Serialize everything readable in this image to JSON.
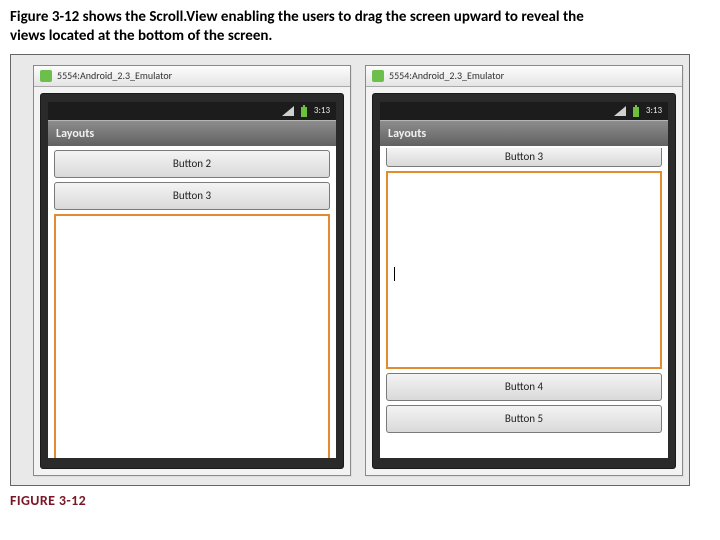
{
  "caption_line1": "Figure 3-12 shows the Scroll.View enabling the users to drag the screen upward to reveal the",
  "caption_line2": "views located at the bottom of the screen.",
  "figure_label": "FIGURE 3-12",
  "emulators": {
    "left": {
      "title": "5554:Android_2.3_Emulator",
      "time": "3:13",
      "appbar": "Layouts",
      "buttons": {
        "b2": "Button 2",
        "b3": "Button 3"
      }
    },
    "right": {
      "title": "5554:Android_2.3_Emulator",
      "time": "3:13",
      "appbar": "Layouts",
      "buttons": {
        "b3": "Button 3",
        "b4": "Button 4",
        "b5": "Button 5"
      }
    }
  }
}
